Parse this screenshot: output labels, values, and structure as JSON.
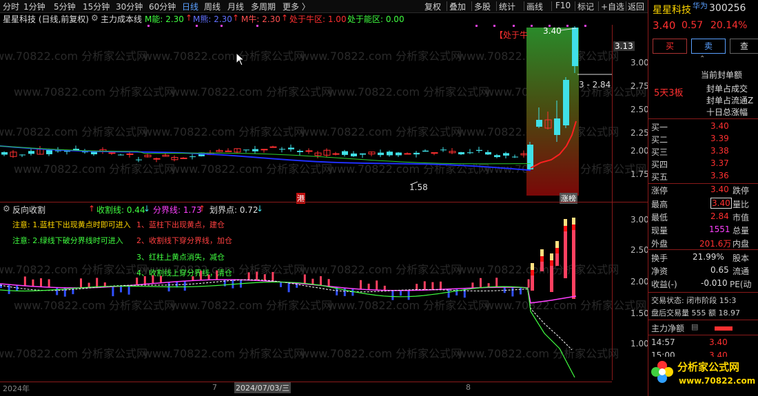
{
  "toolbar": {
    "periods": [
      "分时",
      "1分钟",
      "5分钟",
      "15分钟",
      "30分钟",
      "60分钟",
      "日线",
      "周线",
      "月线",
      "多周期",
      "更多 〉"
    ],
    "active_period": "日线",
    "right_tools": [
      "复权",
      "叠加",
      "多股",
      "统计",
      "画线",
      "F10",
      "标记",
      "+自选",
      "返回"
    ]
  },
  "legend": {
    "stock_title": "星星科技 (日线,前复权)",
    "indicator_name": "主力成本线",
    "m_energy_label": "M能: 2.30",
    "m_bear_label": "M熊: 2.30",
    "m_bull_label": "M牛: 2.30",
    "bull_zone": "处于牛区: 1.00",
    "energy_zone": "处于能区: 0.00"
  },
  "chart": {
    "high_tag": "3.40",
    "low_tag": "1.58",
    "mid_tag": "3 - 2.84",
    "bull_box_tag": "【处于牛",
    "price_flag": "3.13",
    "gang_label": "港",
    "zhangting_label": "涨榜",
    "y_ticks": [
      "3.00",
      "2.75",
      "2.50",
      "2.25",
      "2.00",
      "1.75"
    ]
  },
  "sub": {
    "name": "反向收割",
    "cut_label": "收割线: 0.44",
    "fen_label": "分界线: 1.73",
    "hua_label": "划界点: 0.72",
    "notes": [
      {
        "text": "注意: 1.蓝柱下出现黄点时即可进入",
        "color": "#ffd700"
      },
      {
        "text": "1、蓝柱下出现黄点，建仓",
        "color": "#ff4040"
      },
      {
        "text": "注意: 2.绿线下破分界线时可进入",
        "color": "#40ff40"
      },
      {
        "text": "2、收割线下穿分界线，加仓",
        "color": "#ff4040"
      },
      {
        "text": "3、红柱上黄点消失，减仓",
        "color": "#40ff40"
      },
      {
        "text": "4、收割线上穿分界线，清仓",
        "color": "#40ff40"
      }
    ],
    "y_ticks": [
      "3.00",
      "2.50",
      "2.00",
      "1.50",
      "1.00"
    ]
  },
  "xaxis": {
    "labels": [
      "2024年",
      "7",
      "2024/07/03/三",
      "8"
    ]
  },
  "watermark": "www.70822.com 分析家公式网",
  "quote": {
    "name": "星星科技",
    "tag": "华为",
    "code": "300256",
    "price": "3.40",
    "change": "0.57",
    "pct": "20.14%",
    "buy_btn": "买",
    "sell_btn": "卖",
    "more_btn": "查",
    "board": "5天3板",
    "seal_items": [
      "当前封单额",
      "封单占成交",
      "封单占流通Z",
      "十日总涨幅"
    ],
    "bids": [
      {
        "label": "买一",
        "val": "3.40"
      },
      {
        "label": "买二",
        "val": "3.39"
      },
      {
        "label": "买三",
        "val": "3.38"
      },
      {
        "label": "买四",
        "val": "3.37"
      },
      {
        "label": "买五",
        "val": "3.36"
      }
    ],
    "limit_up": "涨停",
    "limit_up_val": "3.40",
    "limit_down": "跌停",
    "high": "最高",
    "high_val": "3.40",
    "ratio": "量比",
    "low": "最低",
    "low_val": "2.84",
    "mktcap": "市值",
    "vol": "现量",
    "vol_val": "1551",
    "total": "总量",
    "outer": "外盘",
    "outer_val": "201.6万",
    "inner": "内盘",
    "turnover": "换手",
    "turnover_val": "21.99%",
    "equity": "股本",
    "nav": "净资",
    "nav_val": "0.65",
    "flow": "流通",
    "eps": "收益(-)",
    "eps_val": "-0.010",
    "pe": "PE(动",
    "status": "交易状态: 闭市阶段 15:3",
    "after": "盘后交易量 555 额 18.97",
    "net": "主力净额",
    "t1": "14:57",
    "t1_val": "3.40",
    "t2": "15:00",
    "t2_val": "3.40",
    "logo": "分析家公式网",
    "logo_url": "www.70822.com"
  },
  "colors": {
    "up": "#ff3030",
    "down": "#40e0e8",
    "blue_line": "#2030ff",
    "green_line": "#30d030",
    "bg": "#000000"
  }
}
